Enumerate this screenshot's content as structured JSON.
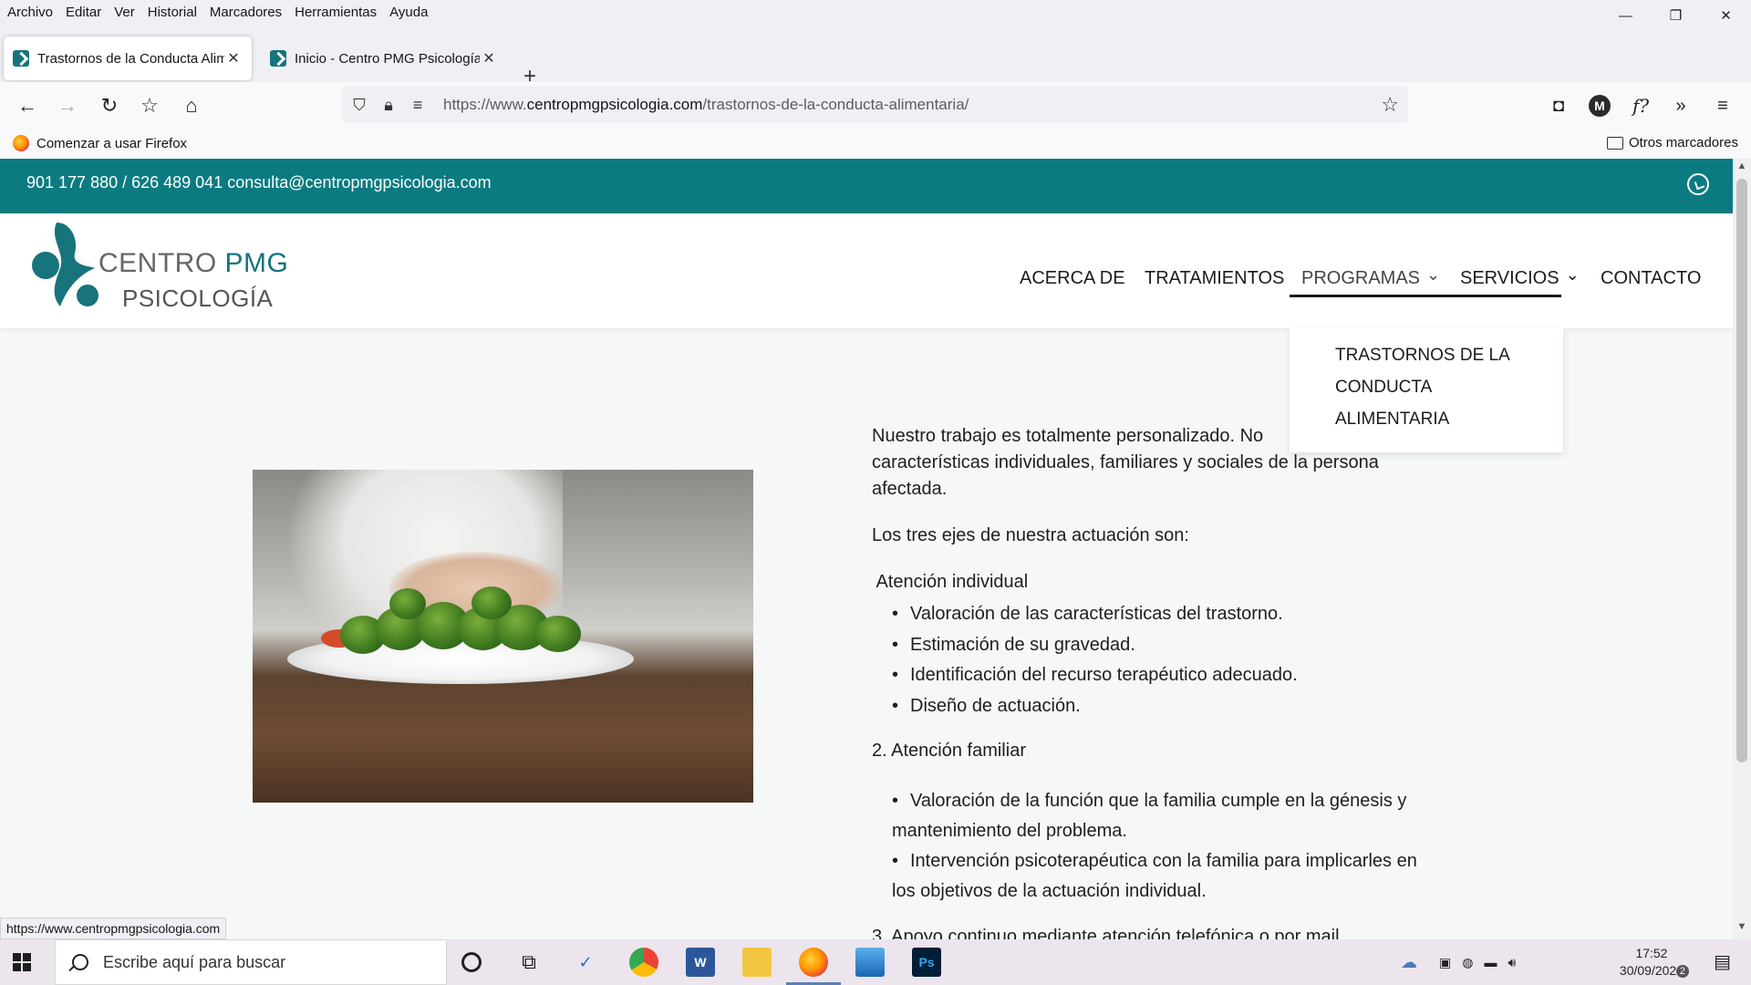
{
  "browser": {
    "menu": [
      "Archivo",
      "Editar",
      "Ver",
      "Historial",
      "Marcadores",
      "Herramientas",
      "Ayuda"
    ],
    "window_controls": {
      "minimize": "—",
      "restore": "❐",
      "close": "✕"
    },
    "tabs": [
      {
        "label": "Trastornos de la Conducta Alim",
        "active": true
      },
      {
        "label": "Inicio - Centro PMG Psicología",
        "active": false
      }
    ],
    "new_tab": "+",
    "url": {
      "prefix": "https://www.",
      "domain": "centropmgpsicologia.com",
      "path": "/trastornos-de-la-conducta-alimentaria/"
    },
    "bookmarks": {
      "first": "Comenzar a usar Firefox",
      "other": "Otros marcadores"
    },
    "toolbar_icons": [
      "pocket-icon",
      "account-icon",
      "formula-icon",
      "overflow-icon",
      "menu-icon"
    ],
    "avatar_letter": "M",
    "status_url": "https://www.centropmgpsicologia.com"
  },
  "site": {
    "contact_line": "901 177 880 / 626 489 041 consulta@centropmgpsicologia.com",
    "logo": {
      "line1_a": "CENTRO ",
      "line1_b": "PMG",
      "line2": "PSICOLOGÍA"
    },
    "nav": [
      {
        "label": "ACERCA DE"
      },
      {
        "label": "TRATAMIENTOS"
      },
      {
        "label": "PROGRAMAS",
        "dropdown": true
      },
      {
        "label": "SERVICIOS",
        "dropdown": true
      },
      {
        "label": "CONTACTO"
      }
    ],
    "dropdown_item": "TRASTORNOS DE LA CONDUCTA ALIMENTARIA",
    "intro": "Nuestro trabajo es totalmente personalizado. No",
    "intro_line2": "características individuales, familiares y sociales de la persona",
    "intro_line3": "afectada.",
    "axes_title": "Los tres ejes de nuestra actuación son:",
    "section1_title": " Atención individual",
    "section1_items": [
      "Valoración de las características del trastorno.",
      "Estimación de su gravedad.",
      "Identificación del recurso terapéutico adecuado.",
      "Diseño de actuación."
    ],
    "section2_title": "2. Atención familiar",
    "section2_items": [
      {
        "l1": "Valoración de la función que la familia cumple en la génesis y",
        "l2": "mantenimiento del problema."
      },
      {
        "l1": "Intervención psicoterapéutica con la familia para implicarles en",
        "l2": "los objetivos de la actuación individual."
      }
    ],
    "section3_partial": "3. Apoyo continuo mediante atención telefónica o por mail"
  },
  "taskbar": {
    "search_placeholder": "Escribe aquí para buscar",
    "time": "17:52",
    "date": "30/09/2021",
    "notif_count": "2"
  },
  "colors": {
    "brand_teal": "#0b7b81",
    "logo_teal": "#17737c"
  }
}
